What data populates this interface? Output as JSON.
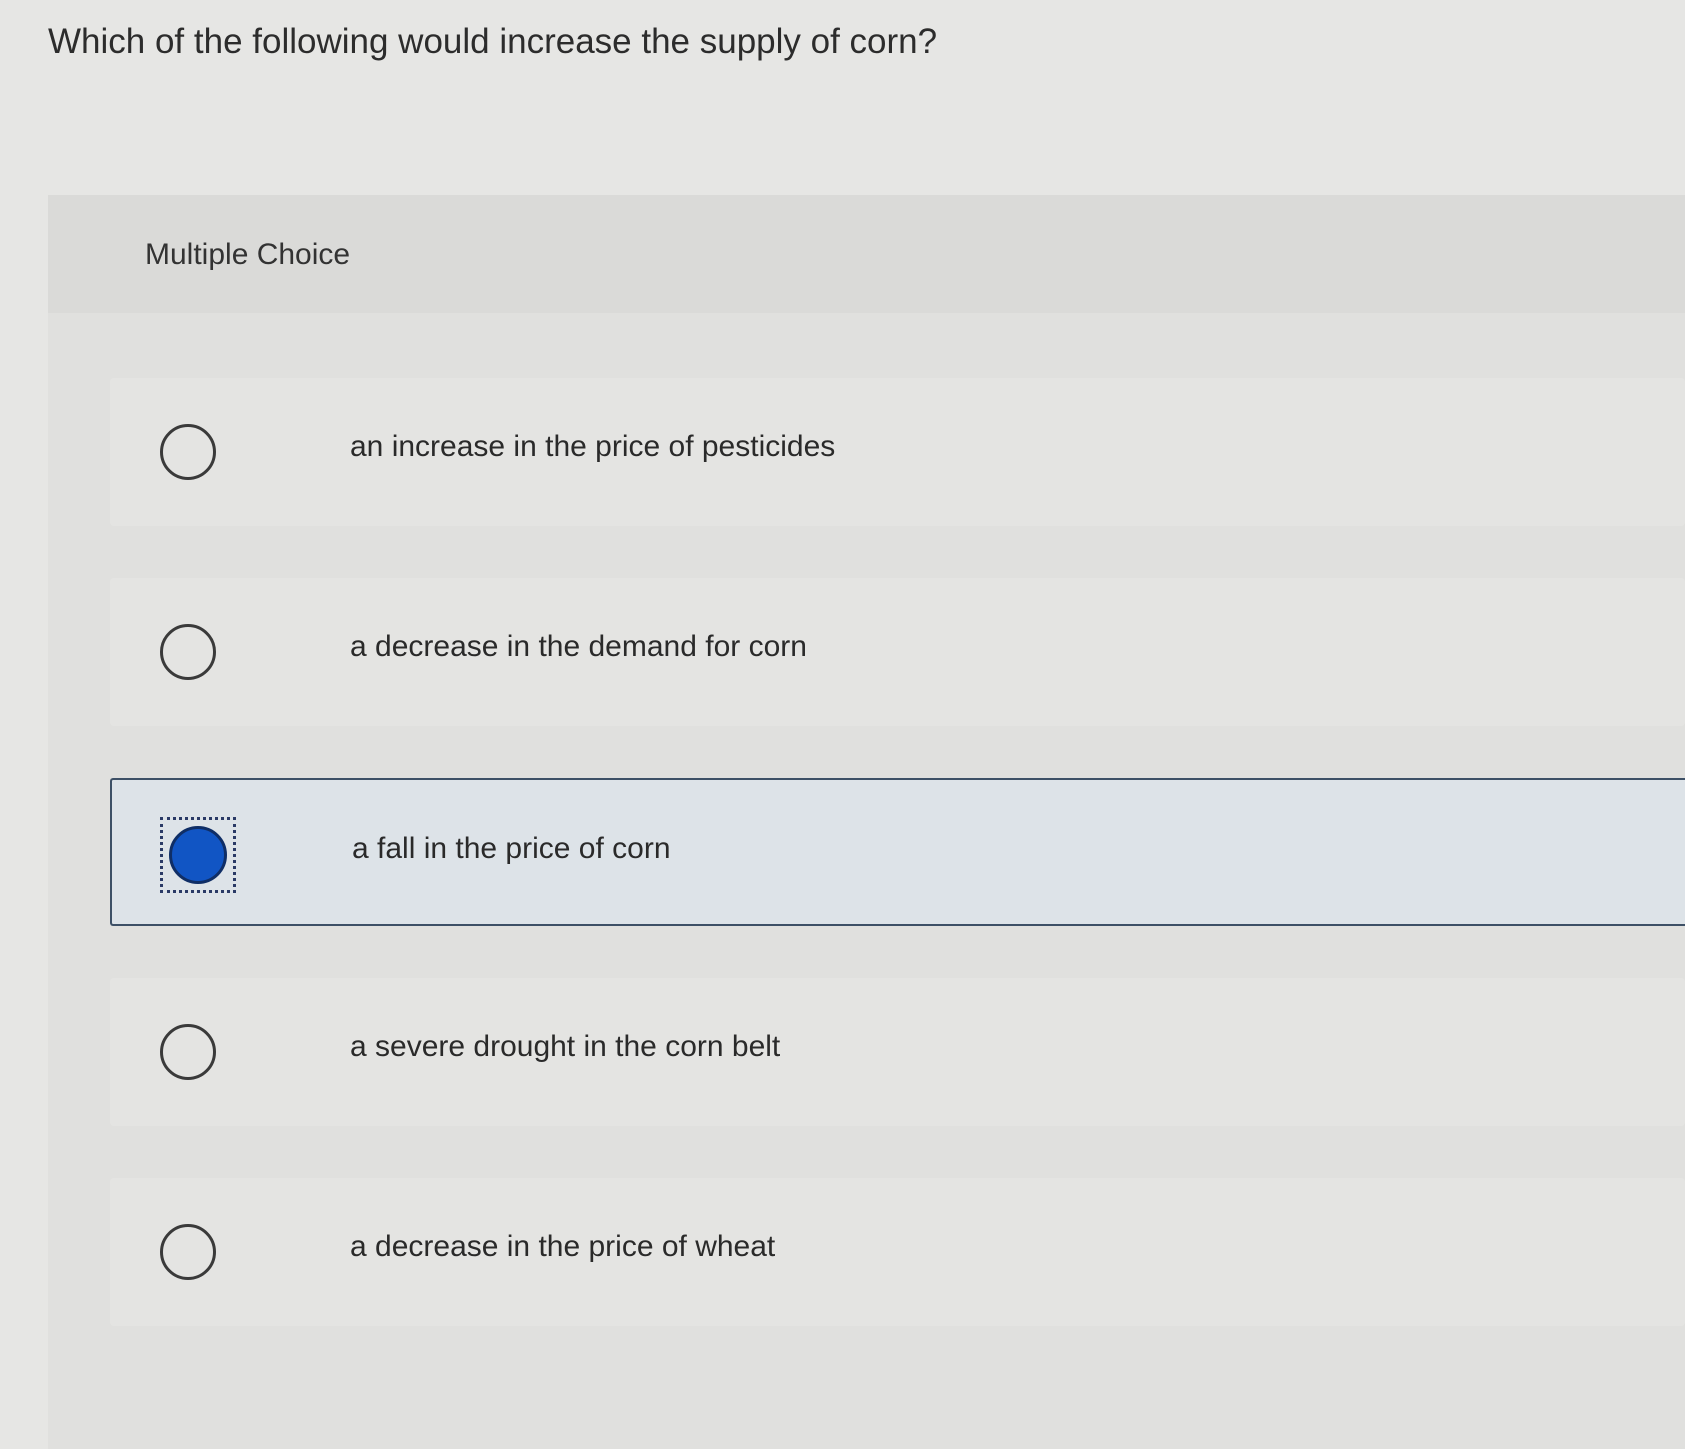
{
  "question": {
    "text": "Which of the following would increase the supply of corn?"
  },
  "panel": {
    "type_label": "Multiple Choice"
  },
  "options": [
    {
      "label": "an increase in the price of pesticides",
      "selected": false
    },
    {
      "label": "a decrease in the demand for corn",
      "selected": false
    },
    {
      "label": "a fall in the price of corn",
      "selected": true
    },
    {
      "label": "a severe drought in the corn belt",
      "selected": false
    },
    {
      "label": "a decrease in the price of wheat",
      "selected": false
    }
  ],
  "colors": {
    "selected_fill": "#1155c4",
    "selected_border": "#3d5066",
    "background": "#e6e6e4"
  }
}
